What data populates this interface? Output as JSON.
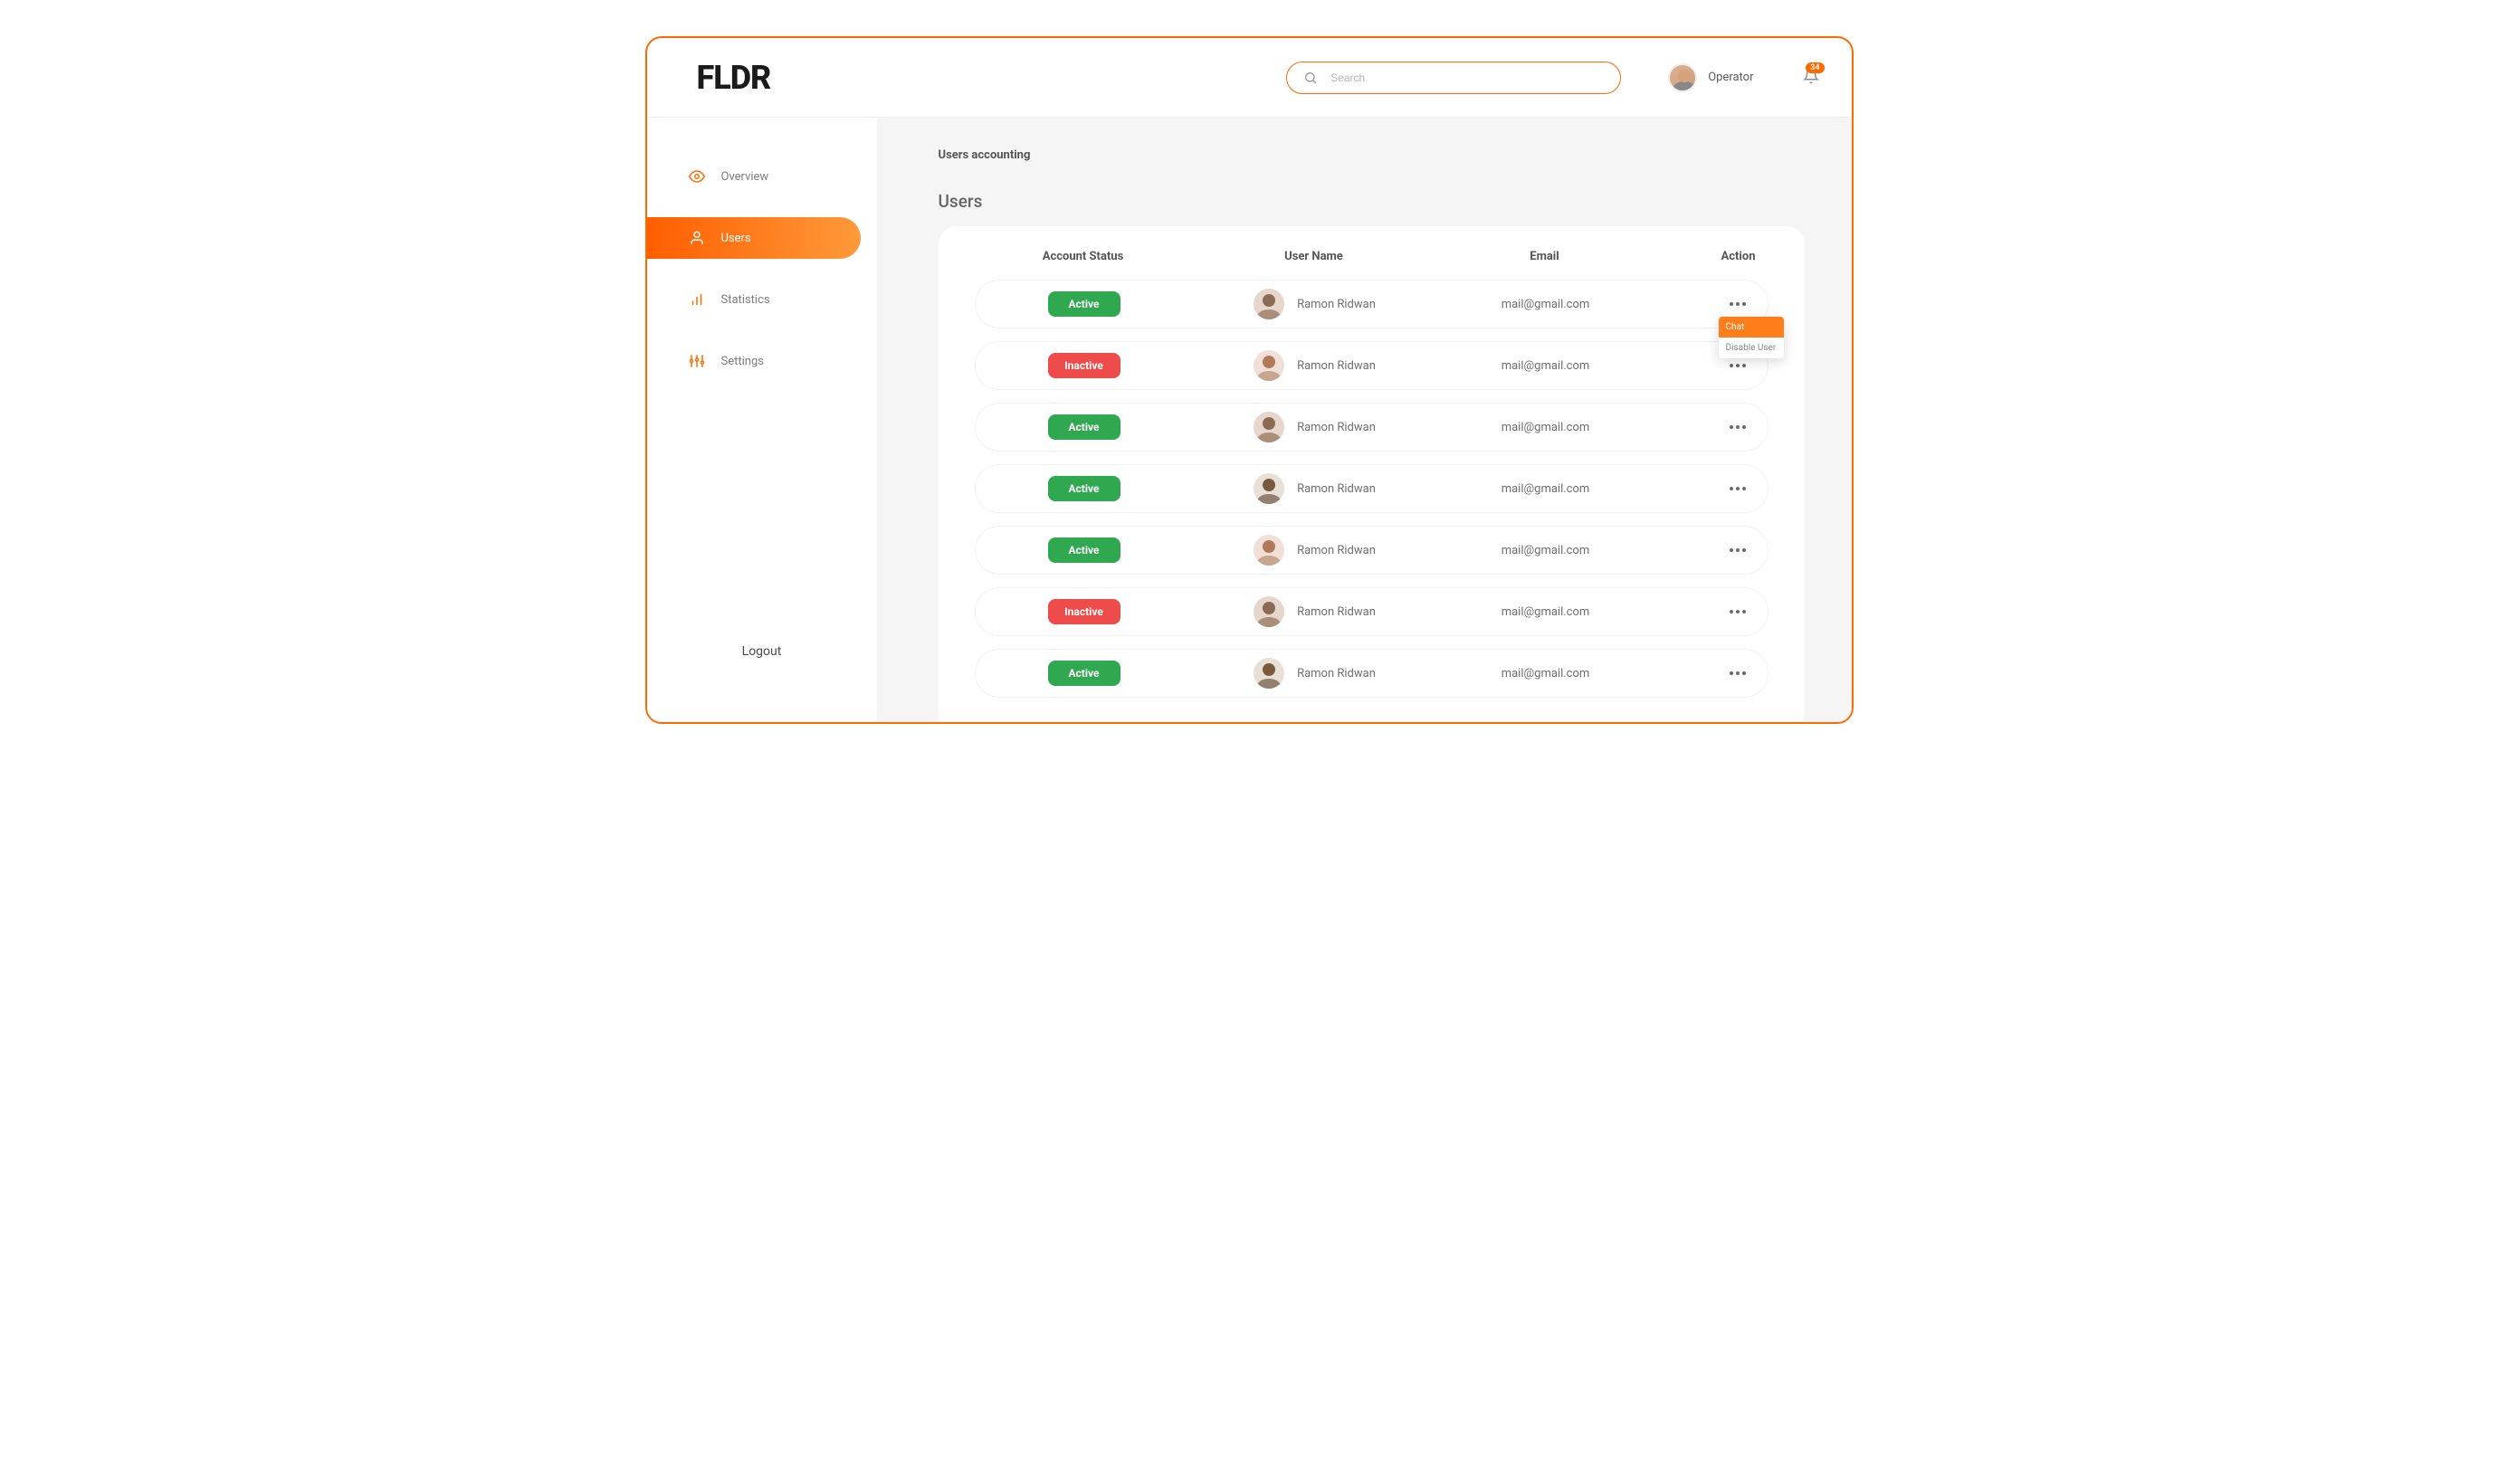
{
  "brand": "FLDR",
  "search": {
    "placeholder": "Search"
  },
  "user": {
    "role": "Operator"
  },
  "notifications": {
    "count": "34"
  },
  "sidebar": {
    "items": [
      {
        "label": "Overview"
      },
      {
        "label": "Users"
      },
      {
        "label": "Statistics"
      },
      {
        "label": "Settings"
      }
    ],
    "logout": "Logout"
  },
  "page": {
    "breadcrumb": "Users accounting",
    "title": "Users"
  },
  "table": {
    "headers": {
      "status": "Account Status",
      "name": "User Name",
      "email": "Email",
      "action": "Action"
    },
    "rows": [
      {
        "status": "Active",
        "status_kind": "active",
        "name": "Ramon Ridwan",
        "email": "mail@gmail.com"
      },
      {
        "status": "Inactive",
        "status_kind": "inactive",
        "name": "Ramon Ridwan",
        "email": "mail@gmail.com"
      },
      {
        "status": "Active",
        "status_kind": "active",
        "name": "Ramon Ridwan",
        "email": "mail@gmail.com"
      },
      {
        "status": "Active",
        "status_kind": "active",
        "name": "Ramon Ridwan",
        "email": "mail@gmail.com"
      },
      {
        "status": "Active",
        "status_kind": "active",
        "name": "Ramon Ridwan",
        "email": "mail@gmail.com"
      },
      {
        "status": "Inactive",
        "status_kind": "inactive",
        "name": "Ramon Ridwan",
        "email": "mail@gmail.com"
      },
      {
        "status": "Active",
        "status_kind": "active",
        "name": "Ramon Ridwan",
        "email": "mail@gmail.com"
      }
    ],
    "action_menu": {
      "chat": "Chat",
      "disable": "Disable User"
    }
  },
  "colors": {
    "accent": "#ff6a00",
    "active_pill": "#2fa84f",
    "inactive_pill": "#ee4b4b"
  }
}
